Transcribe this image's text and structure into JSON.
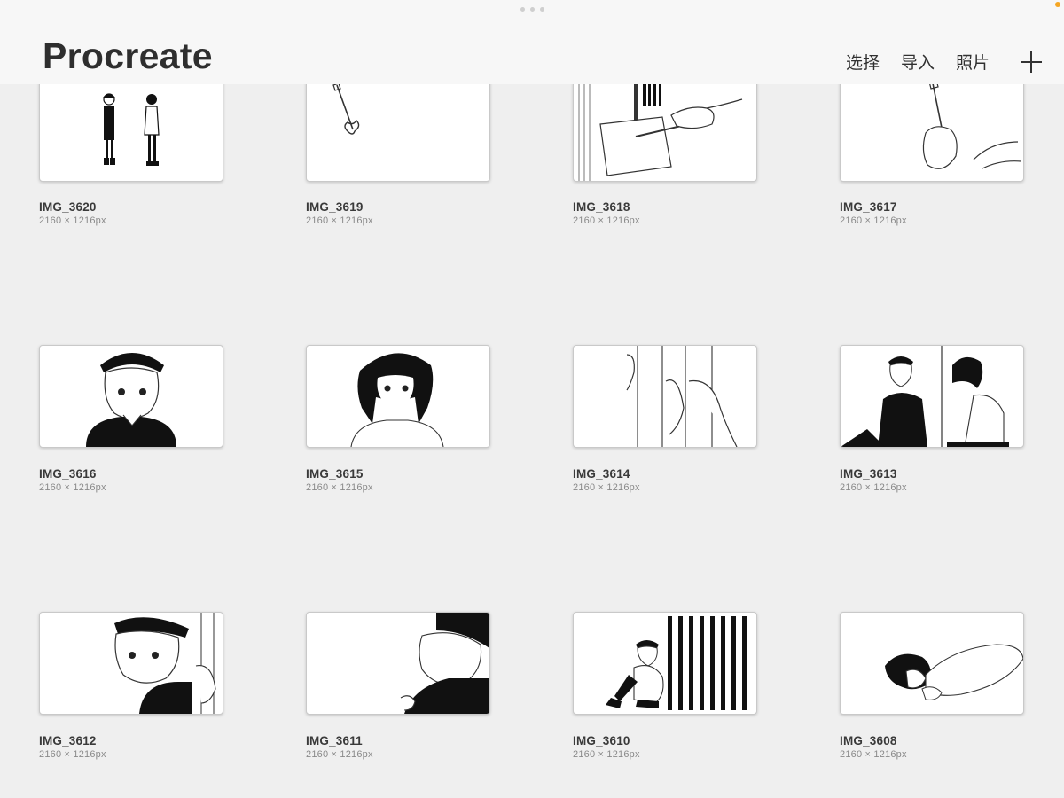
{
  "app": {
    "title": "Procreate"
  },
  "toolbar": {
    "select_label": "选择",
    "import_label": "导入",
    "photo_label": "照片",
    "add_icon": "plus-icon"
  },
  "gallery": {
    "items": [
      {
        "name": "IMG_3620",
        "size": "2160 × 1216px"
      },
      {
        "name": "IMG_3619",
        "size": "2160 × 1216px"
      },
      {
        "name": "IMG_3618",
        "size": "2160 × 1216px"
      },
      {
        "name": "IMG_3617",
        "size": "2160 × 1216px"
      },
      {
        "name": "IMG_3616",
        "size": "2160 × 1216px"
      },
      {
        "name": "IMG_3615",
        "size": "2160 × 1216px"
      },
      {
        "name": "IMG_3614",
        "size": "2160 × 1216px"
      },
      {
        "name": "IMG_3613",
        "size": "2160 × 1216px"
      },
      {
        "name": "IMG_3612",
        "size": "2160 × 1216px"
      },
      {
        "name": "IMG_3611",
        "size": "2160 × 1216px"
      },
      {
        "name": "IMG_3610",
        "size": "2160 × 1216px"
      },
      {
        "name": "IMG_3608",
        "size": "2160 × 1216px"
      }
    ]
  },
  "colors": {
    "background": "#efefef",
    "header": "#f7f7f7",
    "status_dot": "#f5a623"
  }
}
